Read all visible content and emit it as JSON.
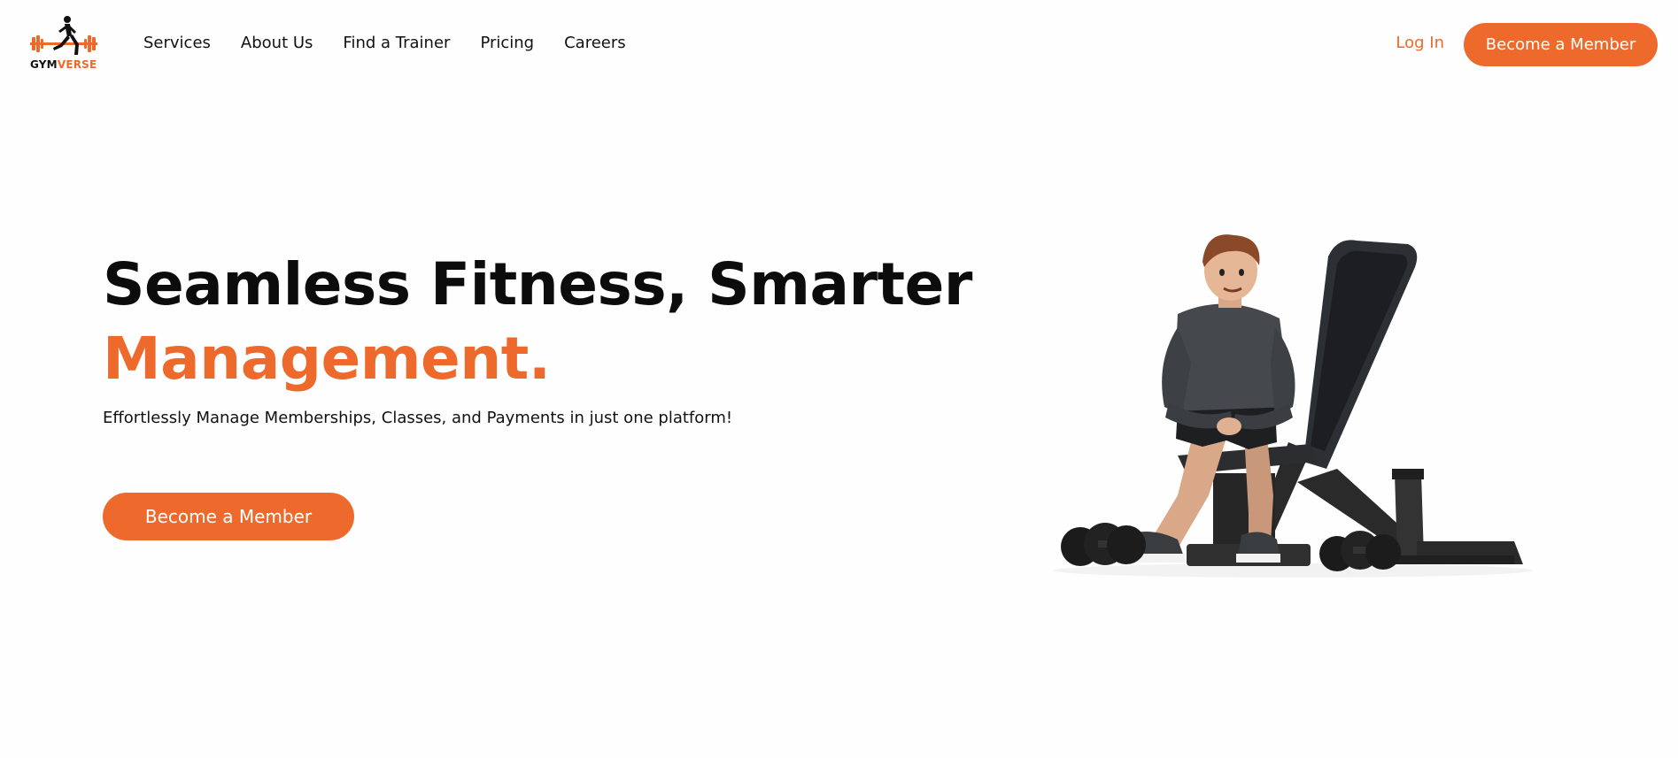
{
  "brand": {
    "logo_part1": "GYM",
    "logo_part2": "VERSE",
    "accent_color": "#ed6a2c",
    "text_color": "#111111",
    "background_color": "#ffffff"
  },
  "nav": {
    "items": [
      "Services",
      "About Us",
      "Find a Trainer",
      "Pricing",
      "Careers"
    ]
  },
  "header": {
    "login_label": "Log In",
    "cta_label": "Become a Member"
  },
  "hero": {
    "title_line1": "Seamless Fitness, Smarter",
    "title_line2": "Management.",
    "subtitle": "Effortlessly Manage Memberships, Classes, and Payments in just one platform!",
    "cta_label": "Become a Member",
    "illustration": "man-sitting-on-weight-bench-with-dumbbells"
  },
  "icons": {
    "logo": "runner-with-barbell-icon"
  }
}
